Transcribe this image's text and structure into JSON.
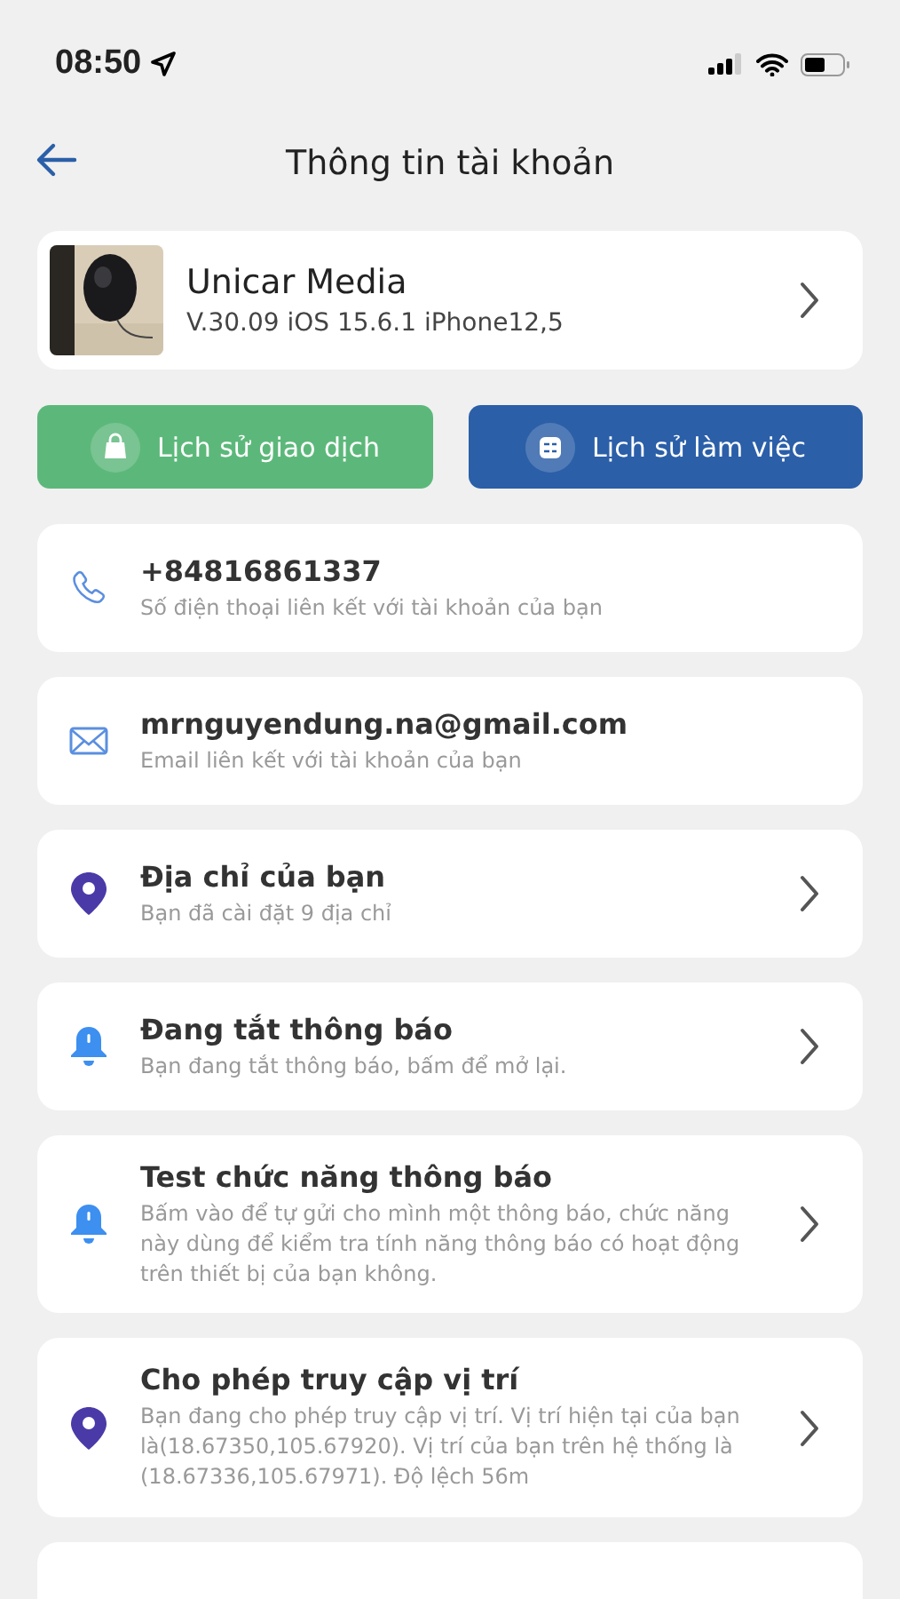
{
  "status_bar": {
    "time": "08:50"
  },
  "header": {
    "title": "Thông tin tài khoản"
  },
  "profile": {
    "kind": "picture",
    "name": "Unicar Media",
    "version": "V.30.09 iOS 15.6.1 iPhone12,5"
  },
  "actions": [
    {
      "label": "Lịch sử giao dịch",
      "kind": "bag",
      "color": "#5cb87a"
    },
    {
      "label": "Lịch sử làm việc",
      "kind": "list",
      "color": "#2b5fa8"
    }
  ],
  "items": [
    {
      "kind": "phone",
      "title": "+84816861337",
      "description": "Số điện thoại liên kết với tài khoản của bạn",
      "chevron": false
    },
    {
      "kind": "mail",
      "title": "mrnguyendung.na@gmail.com",
      "description": "Email liên kết với tài khoản của bạn",
      "chevron": false
    },
    {
      "kind": "pin",
      "title": "Địa chỉ của bạn",
      "description": "Bạn đã cài đặt 9 địa chỉ",
      "chevron": true
    },
    {
      "kind": "bell",
      "title": "Đang tắt thông báo",
      "description": "Bạn đang tắt thông báo, bấm để mở lại.",
      "chevron": true
    },
    {
      "kind": "bell",
      "title": "Test chức năng thông báo",
      "description": "Bấm vào để tự gửi cho mình một thông báo, chức năng này dùng để kiểm tra tính năng thông báo có hoạt động trên thiết bị của bạn không.",
      "chevron": true
    },
    {
      "kind": "pin",
      "title": "Cho phép truy cập vị trí",
      "description": "Bạn đang cho phép truy cập vị trí. Vị trí hiện tại của bạn là(18.67350,105.67920). Vị trí của bạn trên hệ thống là (18.67336,105.67971). Độ lệch 56m",
      "chevron": true
    }
  ]
}
